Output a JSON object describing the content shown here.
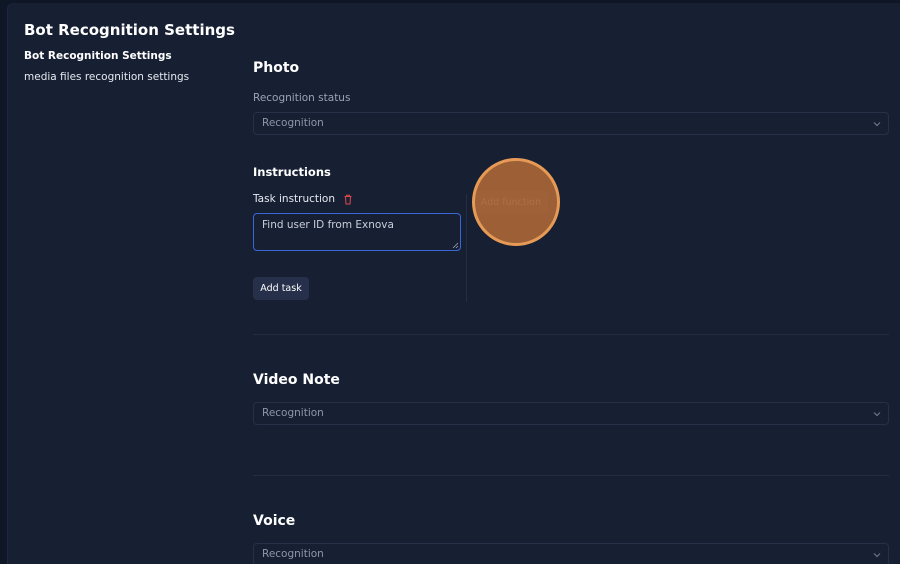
{
  "page": {
    "title": "Bot Recognition Settings"
  },
  "sidebar": {
    "items": [
      {
        "label": "Bot Recognition Settings",
        "active": true
      },
      {
        "label": "media files recognition settings",
        "active": false
      }
    ]
  },
  "photo": {
    "title": "Photo",
    "status_label": "Recognition status",
    "status_value": "Recognition",
    "instructions": {
      "title": "Instructions",
      "task_label": "Task instruction",
      "task_value": "Find user ID from Exnova",
      "add_function_label": "Add function",
      "add_task_label": "Add task"
    }
  },
  "video_note": {
    "title": "Video Note",
    "status_value": "Recognition"
  },
  "voice": {
    "title": "Voice",
    "status_value": "Recognition"
  },
  "icons": {
    "chevron": "chevron-down-icon",
    "trash": "trash-icon",
    "resize": "resize-handle-icon"
  },
  "colors": {
    "background": "#172033",
    "focus_border": "#3a66d6",
    "trash": "#e0474c",
    "cursor_highlight": "#e79a55"
  }
}
